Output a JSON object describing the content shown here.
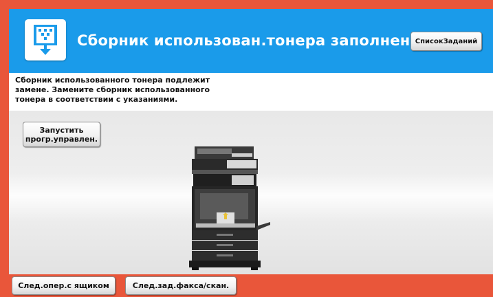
{
  "header": {
    "title": "Сборник использован.тонера заполнен.",
    "job_list_label": "СписокЗаданий",
    "icon": "waste-toner-icon"
  },
  "message": {
    "text": "Сборник использованного тонера подлежит\nзамене. Замените сборник использованного\nтонера в соответствии с указаниями."
  },
  "actions": {
    "remote_panel_label": "Запустить\nпрогр.управлен."
  },
  "bottom": {
    "next_tray_label": "След.опер.с ящиком",
    "next_fax_label": "След.зад.факса/скан."
  },
  "colors": {
    "frame": "#e9563a",
    "header": "#1a9bea"
  }
}
